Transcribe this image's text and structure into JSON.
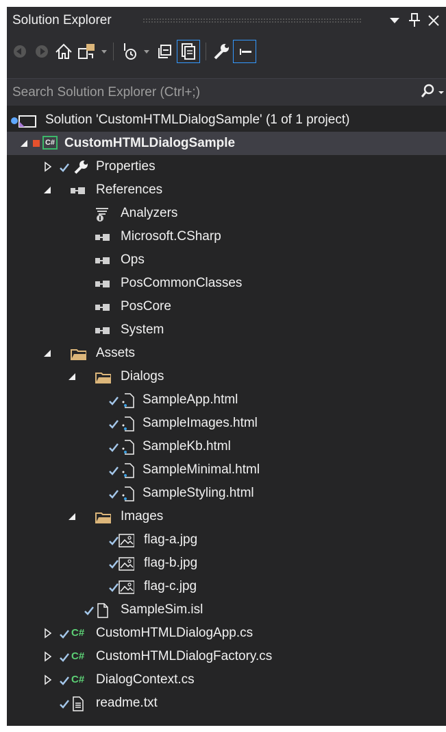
{
  "window": {
    "title": "Solution Explorer",
    "accent_color": "#3399ff"
  },
  "search": {
    "placeholder": "Search Solution Explorer (Ctrl+;)"
  },
  "toolbar": {
    "tools": [
      "back-icon",
      "forward-icon",
      "home-icon",
      "switch-views-icon",
      "pending-changes-filter-icon",
      "collapse-all-icon",
      "show-all-files-icon",
      "properties-icon",
      "preview-icon"
    ]
  },
  "tree": {
    "solution_label": "Solution 'CustomHTMLDialogSample' (1 of 1 project)",
    "project_label": "CustomHTMLDialogSample",
    "project_badge": "C#",
    "properties_label": "Properties",
    "references_label": "References",
    "references": [
      "Analyzers",
      "Microsoft.CSharp",
      "Ops",
      "PosCommonClasses",
      "PosCore",
      "System"
    ],
    "assets_label": "Assets",
    "dialogs_label": "Dialogs",
    "dialogs": [
      "SampleApp.html",
      "SampleImages.html",
      "SampleKb.html",
      "SampleMinimal.html",
      "SampleStyling.html"
    ],
    "images_label": "Images",
    "images": [
      "flag-a.jpg",
      "flag-b.jpg",
      "flag-c.jpg"
    ],
    "samplesim_label": "SampleSim.isl",
    "cs_badge": "C#",
    "cs_files": [
      "CustomHTMLDialogApp.cs",
      "CustomHTMLDialogFactory.cs",
      "DialogContext.cs"
    ],
    "readme_label": "readme.txt"
  }
}
